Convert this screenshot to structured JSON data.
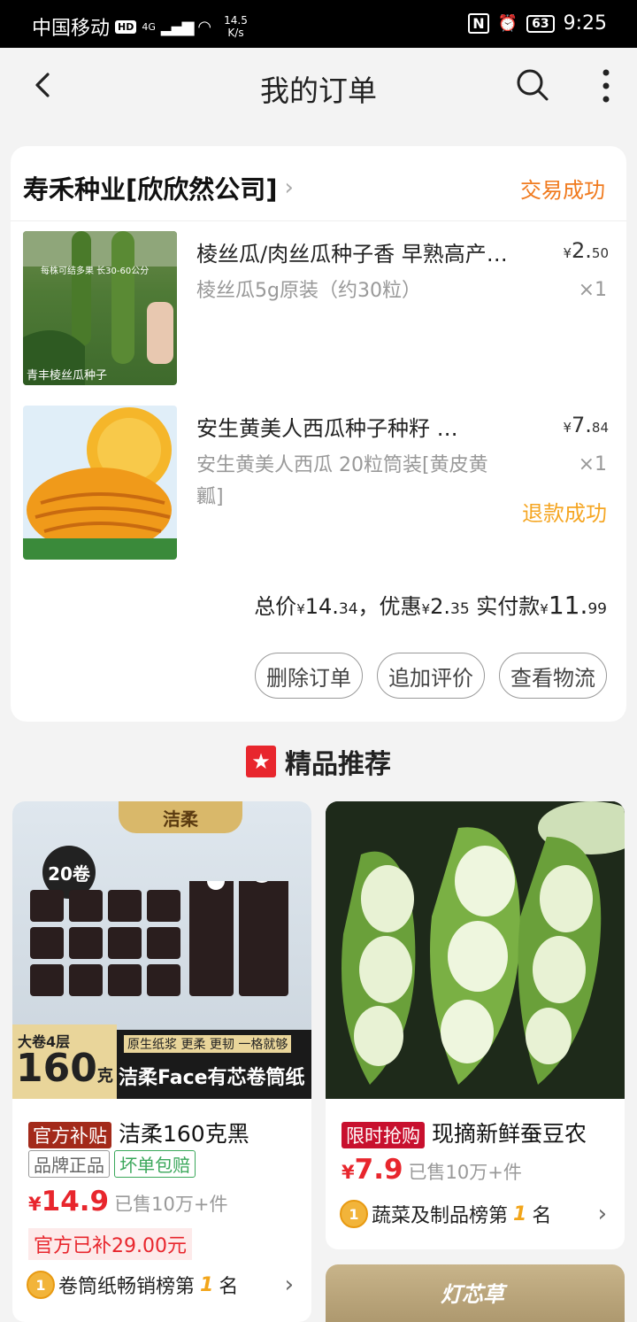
{
  "status_bar": {
    "carrier": "中国移动",
    "hd": "HD",
    "network": "4G",
    "speed_value": "14.5",
    "speed_unit": "K/s",
    "battery": "63",
    "time": "9:25"
  },
  "nav": {
    "title": "我的订单"
  },
  "order": {
    "shop_name": "寿禾种业[欣欣然公司]",
    "status": "交易成功",
    "items": [
      {
        "name": "棱丝瓜/肉丝瓜种子香 早熟高产…",
        "price_int": "2.",
        "price_dec": "50",
        "spec": "棱丝瓜5g原装（约30粒）",
        "qty": "×1",
        "thumb_text1": "每株可结多果 长30-60公分",
        "thumb_text2": "青丰棱丝瓜种子"
      },
      {
        "name": "安生黄美人西瓜种子种籽 …",
        "price_int": "7.",
        "price_dec": "84",
        "spec": "安生黄美人西瓜 20粒筒装[黄皮黄瓤]",
        "qty": "×1",
        "refund": "退款成功"
      }
    ],
    "summary": {
      "total_label": "总价",
      "total_int": "14.",
      "total_dec": "34",
      "discount_label": "，优惠",
      "discount_int": "2.",
      "discount_dec": "35",
      "paid_label": " 实付款",
      "paid_int": "11.",
      "paid_dec": "99"
    },
    "buttons": [
      "删除订单",
      "追加评价",
      "查看物流"
    ]
  },
  "recommend": {
    "title": "精品推荐",
    "products": [
      {
        "tag": "官方补贴",
        "title": "洁柔160克黑",
        "badges": [
          "品牌正品",
          "坏单包赔"
        ],
        "price_int": "14.9",
        "sold": "已售10万+件",
        "subsidy": "官方已补29.00元",
        "rank_text": "卷筒纸畅销榜第",
        "rank_num": "1",
        "rank_suffix": "名",
        "img_brand": "洁柔",
        "img_count": "20卷",
        "img_spec1": "大卷4层",
        "img_weight": "160",
        "img_weight_unit": "克",
        "img_slogan": "原生纸浆 更柔 更韧 一格就够",
        "img_banner": "洁柔Face有芯卷筒纸"
      },
      {
        "tag": "限时抢购",
        "title": "现摘新鲜蚕豆农",
        "price_int": "7.9",
        "sold": "已售10万+件",
        "rank_text": "蔬菜及制品榜第",
        "rank_num": "1",
        "rank_suffix": "名"
      },
      {
        "img_text": "灯芯草"
      }
    ]
  },
  "colors": {
    "accent_orange": "#f07a1e",
    "refund_orange": "#f5a623",
    "price_red": "#e8262d"
  },
  "icons": [
    "back-icon",
    "search-icon",
    "more-icon",
    "chevron-right-icon",
    "star-icon",
    "medal-icon"
  ]
}
